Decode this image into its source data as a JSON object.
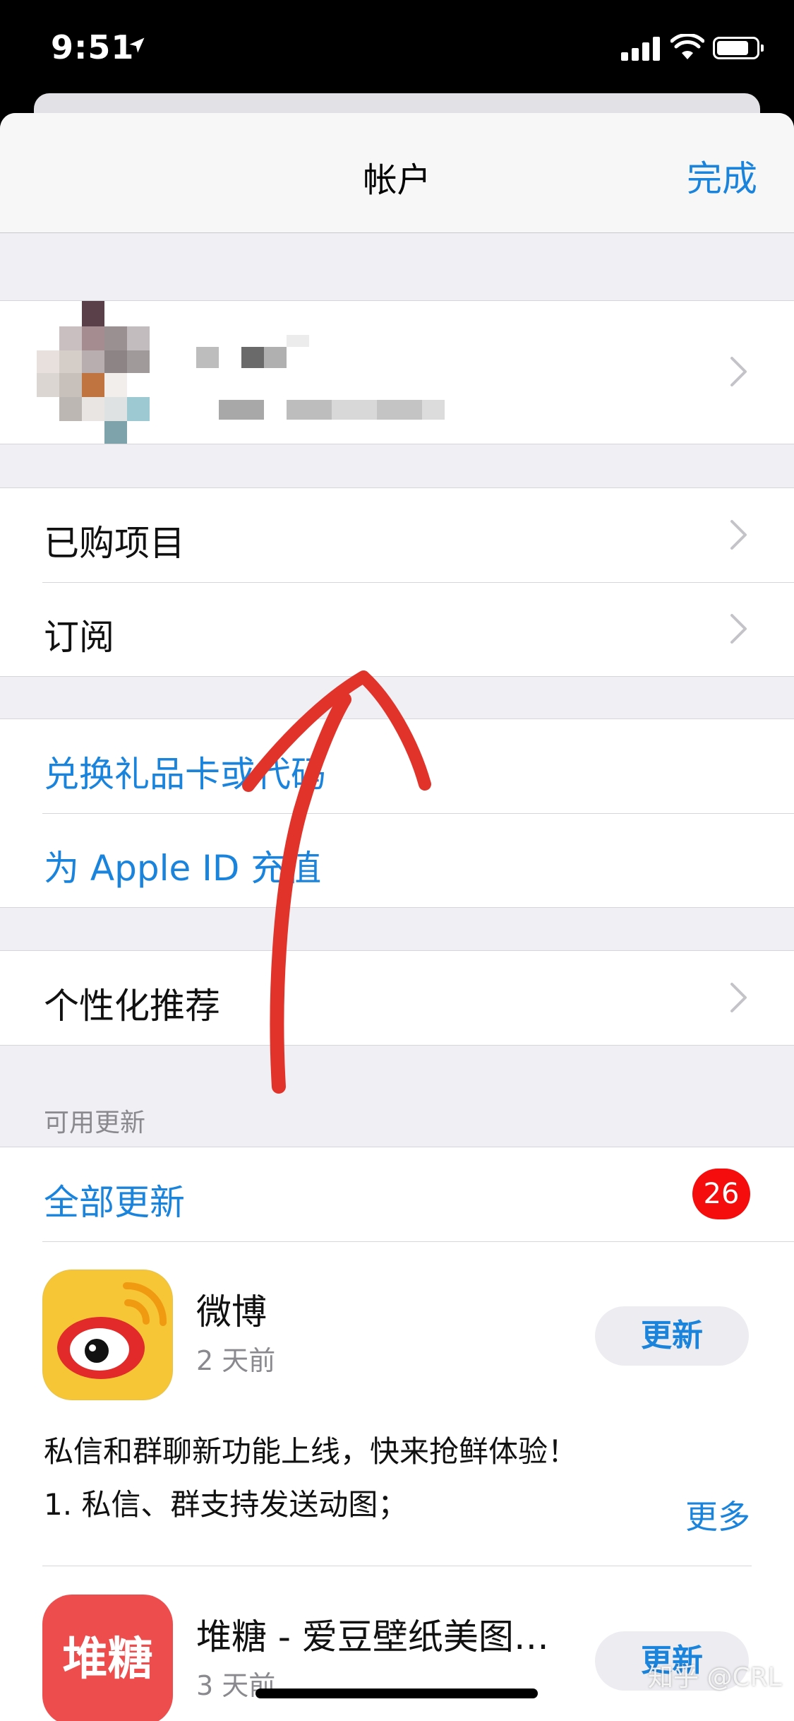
{
  "status_bar": {
    "time": "9:51",
    "location_icon": "location-arrow-icon",
    "signal_icon": "cellular-signal-icon",
    "wifi_icon": "wifi-icon",
    "battery_icon": "battery-icon"
  },
  "nav": {
    "title": "帐户",
    "done_label": "完成"
  },
  "profile": {
    "avatar_icon": "blurred-avatar",
    "chevron_icon": "chevron-right-icon"
  },
  "menu": {
    "purchased": "已购项目",
    "subscriptions": "订阅",
    "redeem": "兑换礼品卡或代码",
    "add_funds": "为 Apple ID 充值",
    "personalized": "个性化推荐"
  },
  "updates": {
    "section_header": "可用更新",
    "update_all": "全部更新",
    "badge_count": "26",
    "apps": [
      {
        "name": "微博",
        "time": "2 天前",
        "button": "更新",
        "notes": [
          "私信和群聊新功能上线，快来抢鲜体验！",
          "1. 私信、群支持发送动图；"
        ],
        "more": "更多",
        "icon": "weibo-app-icon"
      },
      {
        "name": "堆糖 - 爱豆壁纸美图…",
        "time": "3 天前",
        "button": "更新",
        "icon_text": "堆糖",
        "icon": "duitang-app-icon"
      }
    ]
  },
  "watermark": "知乎 @CRL",
  "colors": {
    "accent": "#1a84dd",
    "badge": "#f50c0c",
    "annotation_arrow": "#e2332b",
    "weibo_yellow": "#f6c637",
    "duitang_red": "#ee4d4d"
  }
}
